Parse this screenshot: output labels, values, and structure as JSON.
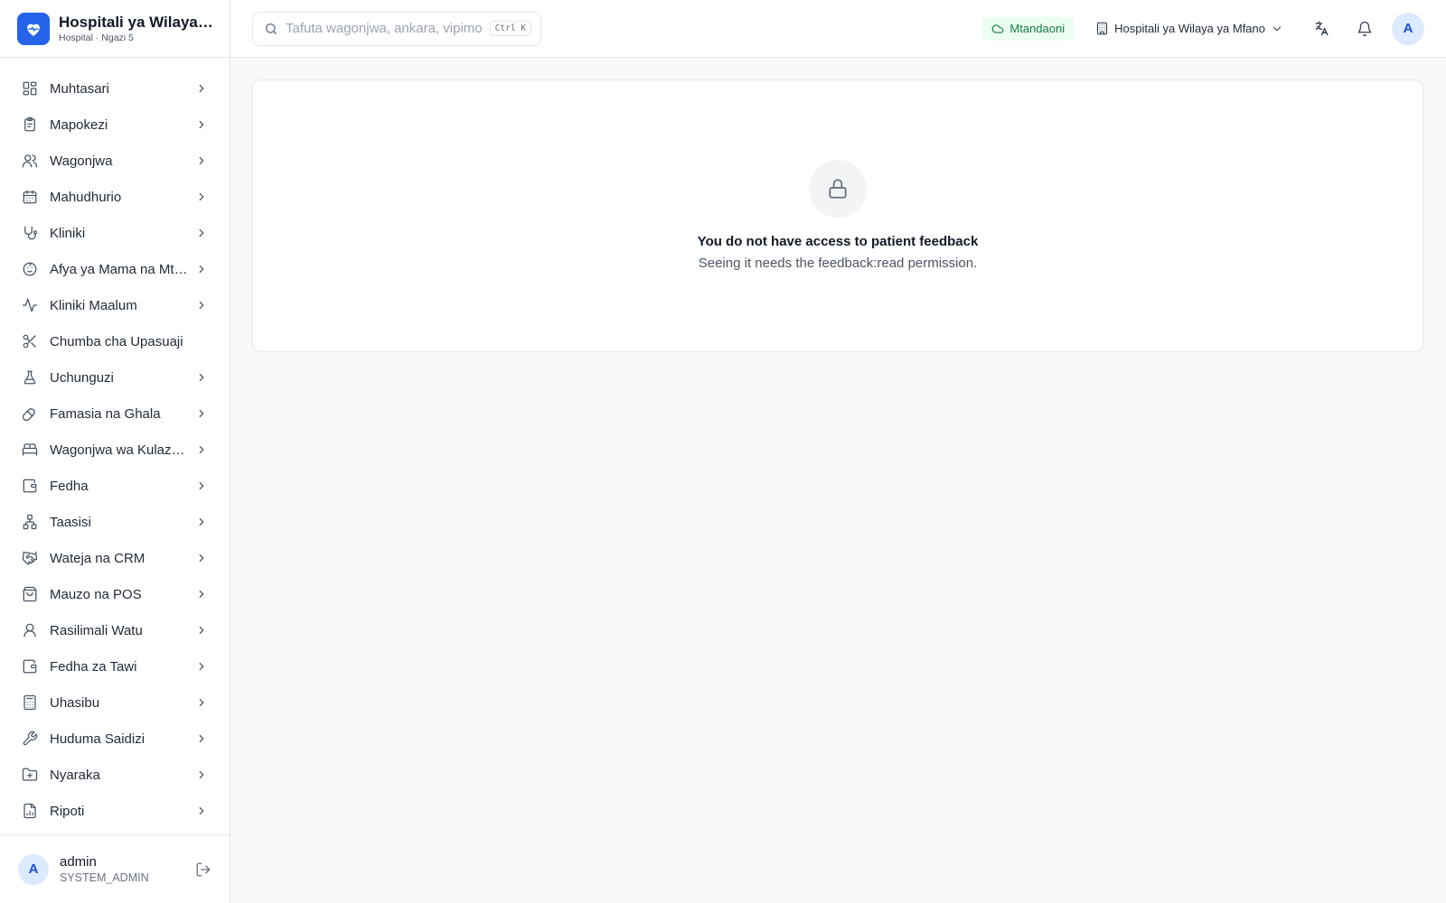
{
  "brand": {
    "name": "Hospitali ya Wilaya ya Mfano",
    "subtitle": "Hospital · Ngazi 5",
    "color": "#2563eb"
  },
  "sidebar": {
    "items": [
      {
        "label": "Muhtasari",
        "icon": "dashboard-icon",
        "has_chevron": true
      },
      {
        "label": "Mapokezi",
        "icon": "clipboard-icon",
        "has_chevron": true
      },
      {
        "label": "Wagonjwa",
        "icon": "users-icon",
        "has_chevron": true
      },
      {
        "label": "Mahudhurio",
        "icon": "calendar-icon",
        "has_chevron": true
      },
      {
        "label": "Kliniki",
        "icon": "stethoscope-icon",
        "has_chevron": true
      },
      {
        "label": "Afya ya Mama na Mtoto",
        "icon": "baby-icon",
        "has_chevron": true
      },
      {
        "label": "Kliniki Maalum",
        "icon": "activity-icon",
        "has_chevron": true
      },
      {
        "label": "Chumba cha Upasuaji",
        "icon": "scissors-icon",
        "has_chevron": false
      },
      {
        "label": "Uchunguzi",
        "icon": "flask-icon",
        "has_chevron": true
      },
      {
        "label": "Famasia na Ghala",
        "icon": "pill-icon",
        "has_chevron": true
      },
      {
        "label": "Wagonjwa wa Kulazwa",
        "icon": "bed-icon",
        "has_chevron": true
      },
      {
        "label": "Fedha",
        "icon": "wallet-icon",
        "has_chevron": true
      },
      {
        "label": "Taasisi",
        "icon": "network-icon",
        "has_chevron": true
      },
      {
        "label": "Wateja na CRM",
        "icon": "handshake-icon",
        "has_chevron": true
      },
      {
        "label": "Mauzo na POS",
        "icon": "shopping-bag-icon",
        "has_chevron": true
      },
      {
        "label": "Rasilimali Watu",
        "icon": "user-icon",
        "has_chevron": true
      },
      {
        "label": "Fedha za Tawi",
        "icon": "wallet-icon",
        "has_chevron": true
      },
      {
        "label": "Uhasibu",
        "icon": "calculator-icon",
        "has_chevron": true
      },
      {
        "label": "Huduma Saidizi",
        "icon": "wrench-icon",
        "has_chevron": true
      },
      {
        "label": "Nyaraka",
        "icon": "folder-icon",
        "has_chevron": true
      },
      {
        "label": "Ripoti",
        "icon": "report-icon",
        "has_chevron": true
      }
    ]
  },
  "user": {
    "initial": "A",
    "name": "admin",
    "role": "SYSTEM_ADMIN"
  },
  "topbar": {
    "search_placeholder": "Tafuta wagonjwa, ankara, vipimo...",
    "shortcut": "Ctrl K",
    "status_label": "Mtandaoni",
    "status_color": "#15803d",
    "facility_label": "Hospitali ya Wilaya ya Mfano",
    "avatar_initial": "A"
  },
  "main": {
    "empty_title": "You do not have access to patient feedback",
    "empty_desc": "Seeing it needs the feedback:read permission."
  }
}
